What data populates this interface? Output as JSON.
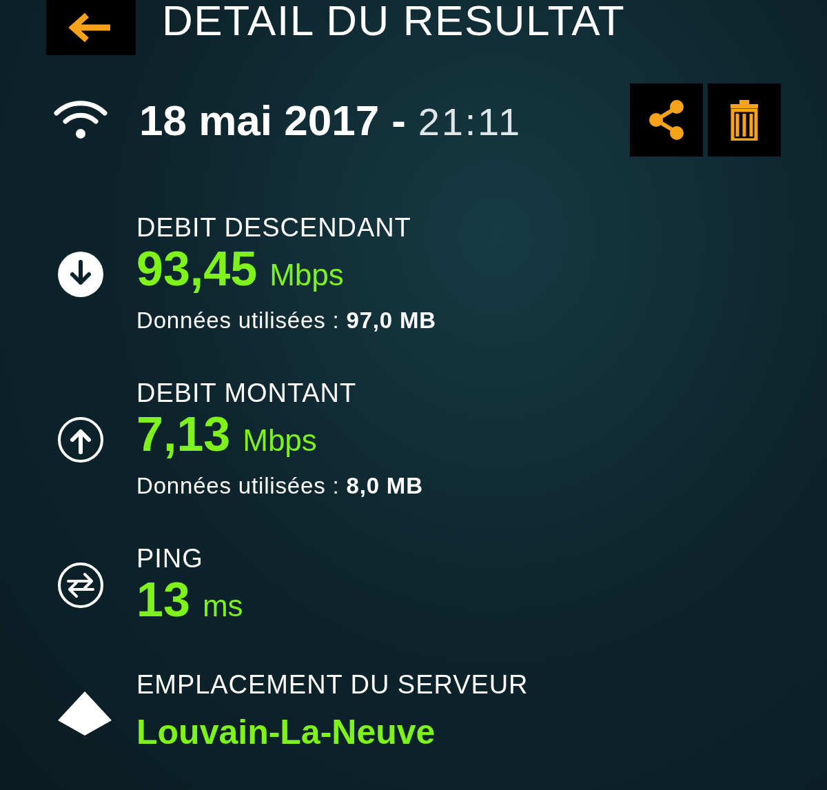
{
  "header": {
    "title": "DETAIL DU RESULTAT"
  },
  "result": {
    "date": "18 mai 2017",
    "separator": "-",
    "time": "21:11"
  },
  "actions": [
    {
      "kind": "share"
    },
    {
      "kind": "delete"
    }
  ],
  "metrics": [
    {
      "kind": "download",
      "label": "DEBIT DESCENDANT",
      "value": "93,45",
      "unit": "Mbps",
      "data_used": "Données utilisées : **97,0 MB**"
    },
    {
      "kind": "upload",
      "label": "DEBIT MONTANT",
      "value": "7,13",
      "unit": "Mbps",
      "data_used": "Données utilisées : **8,0 MB**"
    },
    {
      "kind": "ping",
      "label": "PING",
      "value": "13",
      "unit": "ms"
    },
    {
      "kind": "server",
      "label": "EMPLACEMENT DU SERVEUR",
      "location": "Louvain-La-Neuve"
    }
  ]
}
